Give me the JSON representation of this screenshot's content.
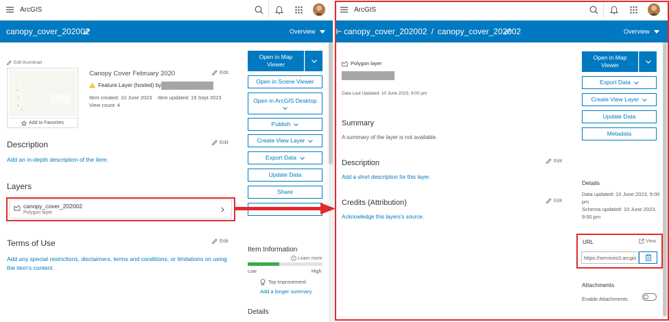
{
  "app_name": "ArcGIS",
  "left": {
    "item_title": "canopy_cover_202002",
    "overview_label": "Overview",
    "edit_thumbnail": "Edit thumbnail",
    "add_to_favorites": "Add to Favorites",
    "item_name": "Canopy Cover February 2020",
    "edit_label": "Edit",
    "feature_layer_label": "Feature Layer (hosted) by",
    "item_created": "Item created: 10 June 2023",
    "item_updated": "Item updated: 19 Sept 2023",
    "view_count": "View count: 4",
    "buttons": {
      "open_map_viewer": "Open in Map Viewer",
      "open_scene_viewer": "Open in Scene Viewer",
      "open_desktop": "Open in ArcGIS Desktop",
      "publish": "Publish",
      "create_view_layer": "Create View Layer",
      "export_data": "Export Data",
      "update_data": "Update Data",
      "share": "Share"
    },
    "description_heading": "Description",
    "description_link": "Add an in-depth description of the item.",
    "layers_heading": "Layers",
    "layer_name": "canopy_cover_202002",
    "layer_type": "Polygon layer",
    "terms_heading": "Terms of Use",
    "terms_link": "Add any special restrictions, disclaimers, terms and conditions, or limitations on using the item's content.",
    "item_information_heading": "Item Information",
    "learn_more": "Learn more",
    "info_low": "Low",
    "info_high": "High",
    "info_progress": 0.42,
    "top_improvement": "Top Improvement:",
    "add_longer_summary": "Add a longer summary",
    "details_heading": "Details"
  },
  "right": {
    "breadcrumb_parent": "canopy_cover_202002",
    "breadcrumb_sep": "/",
    "breadcrumb_current": "canopy_cover_202002",
    "overview_label": "Overview",
    "layer_type": "Polygon layer",
    "data_last_updated": "Data Last Updated: 10 June 2023, 9:00 pm",
    "summary_heading": "Summary",
    "summary_text": "A summary of the layer is not available.",
    "description_heading": "Description",
    "description_link": "Add a short description for this layer.",
    "edit_label": "Edit",
    "credits_heading": "Credits (Attribution)",
    "credits_link": "Acknowledge this layers's source.",
    "buttons": {
      "open_map_viewer": "Open in Map Viewer",
      "export_data": "Export Data",
      "create_view_layer": "Create View Layer",
      "update_data": "Update Data",
      "metadata": "Metadata"
    },
    "details_heading": "Details",
    "data_updated": "Data updated: 10 June 2023, 9:00 pm",
    "schema_updated": "Schema updated: 10 June 2023, 9:00 pm",
    "url_heading": "URL",
    "view_label": "View",
    "url_value": "https://services3.arcgis",
    "attachments_heading": "Attachments",
    "enable_attachments": "Enable Attachments"
  },
  "colors": {
    "brand_blue": "#0079c1",
    "highlight_red": "#e02b2b",
    "progress_green": "#35ac46"
  }
}
